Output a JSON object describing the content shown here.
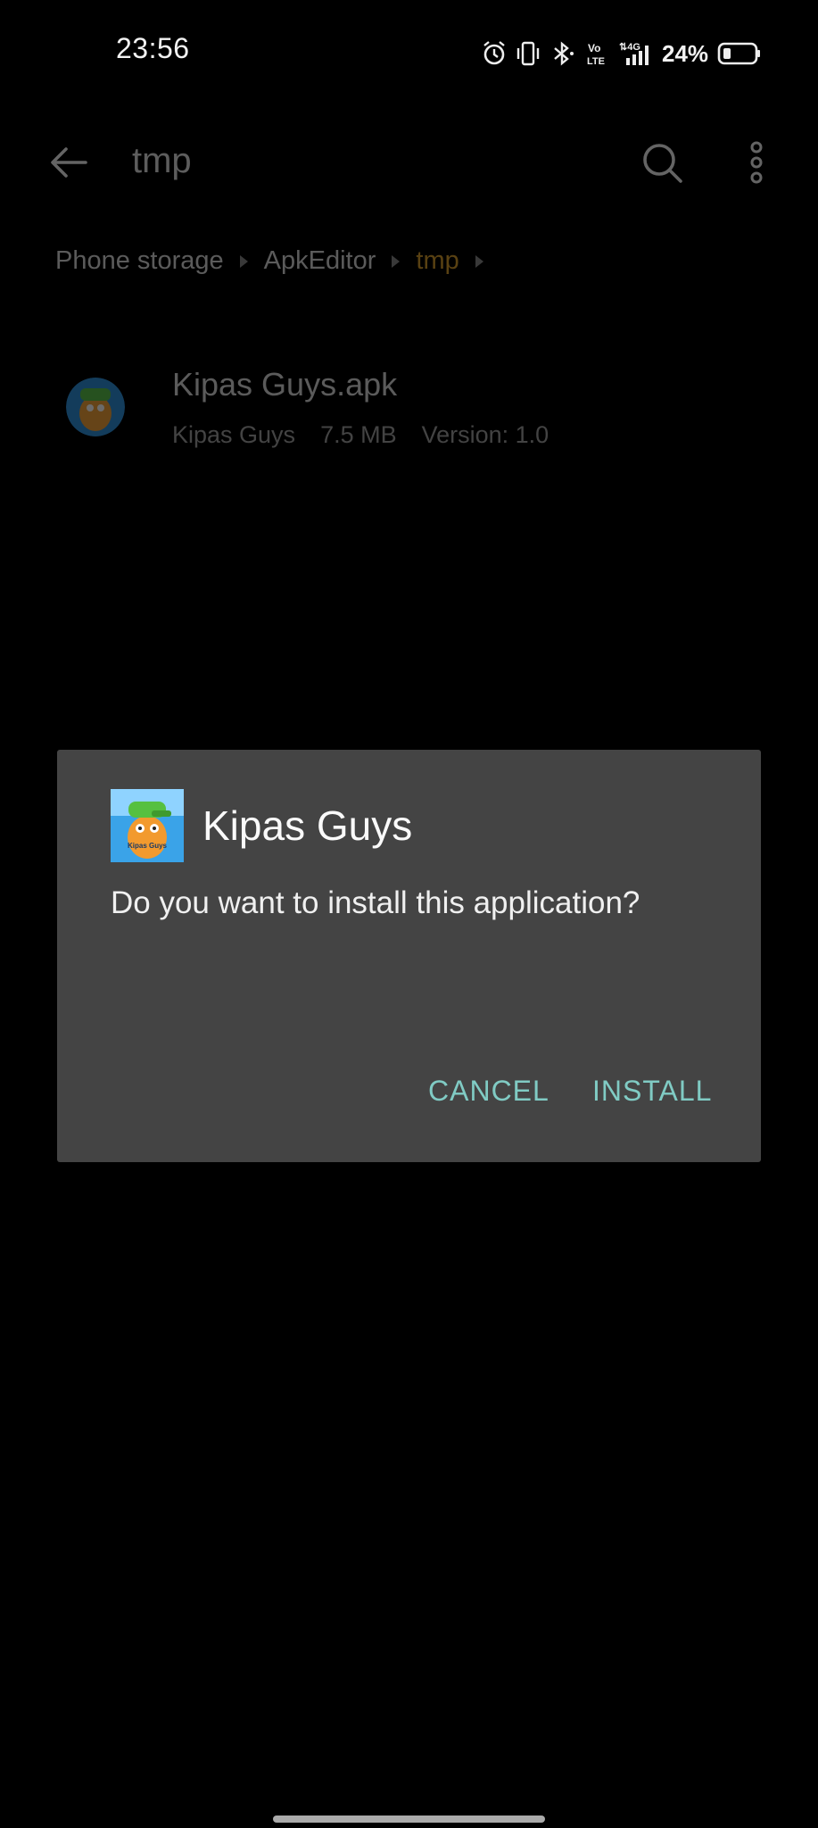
{
  "status_bar": {
    "time": "23:56",
    "battery": "24%",
    "icons": [
      "alarm-icon",
      "vibrate-icon",
      "bluetooth-icon",
      "volte-icon",
      "4g-signal-icon",
      "battery-icon"
    ]
  },
  "toolbar": {
    "title": "tmp",
    "back_icon": "arrow-left-icon",
    "search_icon": "search-icon",
    "more_icon": "more-vertical-icon"
  },
  "breadcrumb": {
    "items": [
      "Phone storage",
      "ApkEditor",
      "tmp"
    ]
  },
  "file": {
    "name": "Kipas Guys.apk",
    "app_name": "Kipas Guys",
    "size": "7.5 MB",
    "version": "Version: 1.0"
  },
  "dialog": {
    "title": "Kipas Guys",
    "message": "Do you want to install this application?",
    "cancel_label": "CANCEL",
    "install_label": "INSTALL",
    "icon_text": "Kipas Guys"
  },
  "colors": {
    "accent": "#80cbc4",
    "breadcrumb_active": "#d39b2c",
    "dialog_bg": "#444444"
  }
}
